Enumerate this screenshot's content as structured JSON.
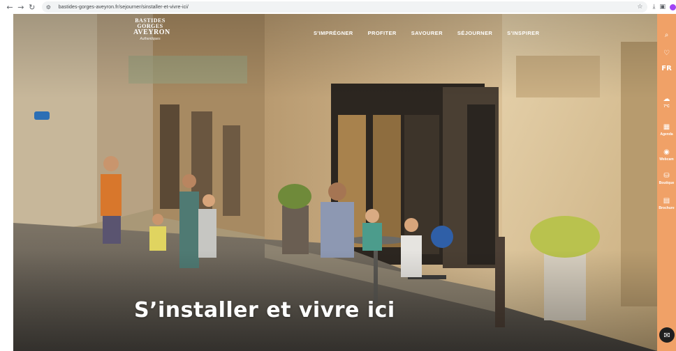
{
  "browser": {
    "back_icon": "arrow-left",
    "forward_icon": "arrow-right",
    "reload_icon": "reload",
    "url": "bastides-gorges-aveyron.fr/sejourner/sinstaller-et-vivre-ici/"
  },
  "site": {
    "logo": {
      "line1": "BASTIDES",
      "line2": "GORGES",
      "line3": "AVEYRON",
      "tagline": "Authentiques"
    },
    "nav": [
      "S'IMPRÉGNER",
      "PROFITER",
      "SAVOURER",
      "SÉJOURNER",
      "S'INSPIRER"
    ],
    "hero_title": "S’installer et vivre ici"
  },
  "sidebar": {
    "accent_color": "#f0a167",
    "language": "FR",
    "weather": "7°C",
    "items": [
      {
        "icon": "calendar-icon",
        "label": "Agenda"
      },
      {
        "icon": "map-pin-icon",
        "label": "Webcam"
      },
      {
        "icon": "basket-icon",
        "label": "Boutique"
      },
      {
        "icon": "book-icon",
        "label": "Brochure"
      }
    ]
  }
}
